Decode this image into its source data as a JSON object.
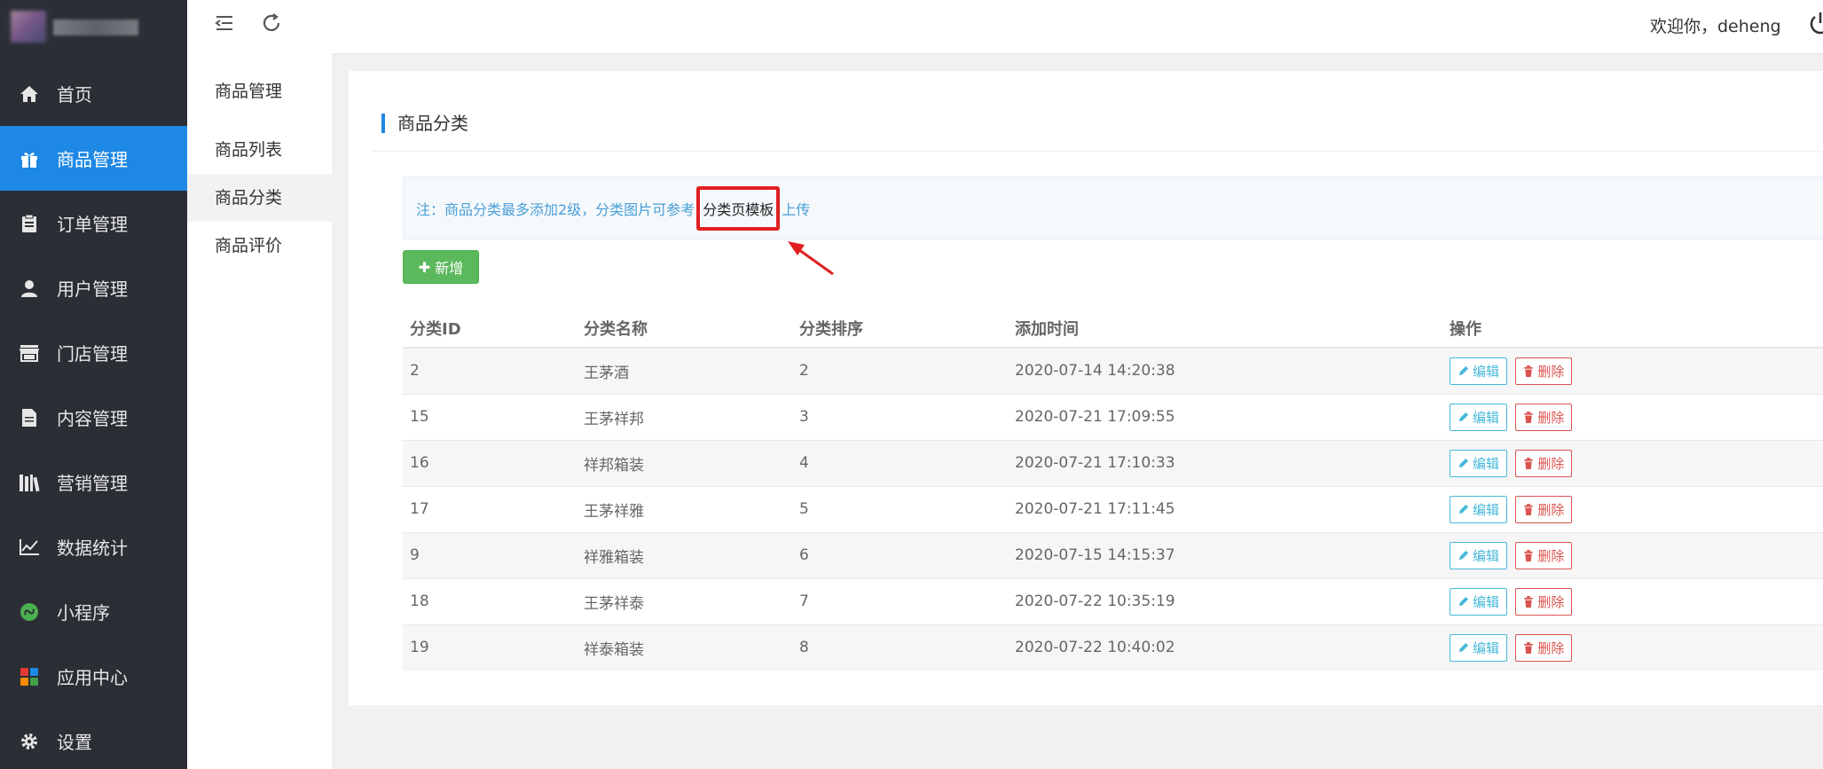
{
  "app": {
    "welcome_text": "欢迎你，deheng"
  },
  "sidebar": {
    "items": [
      {
        "label": "首页",
        "icon": "home-icon"
      },
      {
        "label": "商品管理",
        "icon": "gift-icon",
        "active": true
      },
      {
        "label": "订单管理",
        "icon": "clipboard-icon"
      },
      {
        "label": "用户管理",
        "icon": "user-icon"
      },
      {
        "label": "门店管理",
        "icon": "store-icon"
      },
      {
        "label": "内容管理",
        "icon": "document-icon"
      },
      {
        "label": "营销管理",
        "icon": "books-icon"
      },
      {
        "label": "数据统计",
        "icon": "line-chart-icon"
      },
      {
        "label": "小程序",
        "icon": "mini-program-icon"
      },
      {
        "label": "应用中心",
        "icon": "apps-icon"
      },
      {
        "label": "设置",
        "icon": "gear-icon"
      }
    ]
  },
  "subnav": {
    "title": "商品管理",
    "items": [
      {
        "label": "商品列表"
      },
      {
        "label": "商品分类",
        "active": true
      },
      {
        "label": "商品评价"
      }
    ]
  },
  "main": {
    "title": "商品分类",
    "notice_before": "注：商品分类最多添加2级，分类图片可参考",
    "notice_link": "分类页模板",
    "notice_after": "上传",
    "add_label": "新增",
    "table": {
      "columns": [
        "分类ID",
        "分类名称",
        "分类排序",
        "添加时间",
        "操作"
      ],
      "edit_label": "编辑",
      "delete_label": "删除",
      "rows": [
        {
          "id": "2",
          "name": "王茅酒",
          "sort": "2",
          "time": "2020-07-14 14:20:38"
        },
        {
          "id": "15",
          "name": "王茅祥邦",
          "sort": "3",
          "time": "2020-07-21 17:09:55"
        },
        {
          "id": "16",
          "name": "祥邦箱装",
          "sort": "4",
          "time": "2020-07-21 17:10:33"
        },
        {
          "id": "17",
          "name": "王茅祥雅",
          "sort": "5",
          "time": "2020-07-21 17:11:45"
        },
        {
          "id": "9",
          "name": "祥雅箱装",
          "sort": "6",
          "time": "2020-07-15 14:15:37"
        },
        {
          "id": "18",
          "name": "王茅祥泰",
          "sort": "7",
          "time": "2020-07-22 10:35:19"
        },
        {
          "id": "19",
          "name": "祥泰箱装",
          "sort": "8",
          "time": "2020-07-22 10:40:02"
        }
      ]
    }
  },
  "colors": {
    "sidebar_bg": "#2b2f35",
    "accent": "#1e88e5",
    "add_button": "#5cb85c",
    "highlight_box": "#e02020"
  }
}
